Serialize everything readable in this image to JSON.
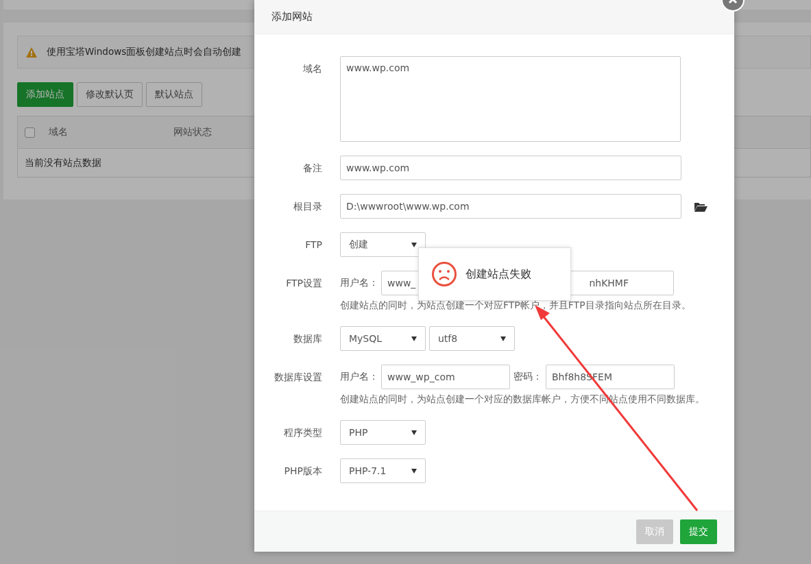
{
  "background": {
    "notice": "使用宝塔Windows面板创建站点时会自动创建",
    "buttons": [
      {
        "label": "添加站点",
        "kind": "primary"
      },
      {
        "label": "修改默认页",
        "kind": "default"
      },
      {
        "label": "默认站点",
        "kind": "default"
      }
    ],
    "table": {
      "header_checked": false,
      "columns": [
        "域名",
        "网站状态"
      ],
      "empty_text": "当前没有站点数据"
    }
  },
  "dialog": {
    "title": "添加网站",
    "rows": [
      {
        "label": "域名",
        "kind": "textarea",
        "value": "www.wp.com"
      },
      {
        "label": "备注",
        "kind": "input",
        "value": "www.wp.com"
      },
      {
        "label": "根目录",
        "kind": "path",
        "value": "D:\\wwwroot\\www.wp.com"
      },
      {
        "label": "FTP",
        "kind": "selects",
        "selects": [
          "创建"
        ]
      },
      {
        "label": "FTP设置",
        "kind": "credentials",
        "user_label": "用户名：",
        "user": "www_",
        "password": "nhKHMF",
        "help": "创建站点的同时，为站点创建一个对应FTP帐户，并且FTP目录指向站点所在目录。"
      },
      {
        "label": "数据库",
        "kind": "selects",
        "selects": [
          "MySQL",
          "utf8"
        ]
      },
      {
        "label": "数据库设置",
        "kind": "credentials",
        "user_label": "用户名：",
        "user": "www_wp_com",
        "password_label": "密码：",
        "password": "Bhf8h8SFEM",
        "help": "创建站点的同时，为站点创建一个对应的数据库帐户，方便不同站点使用不同数据库。"
      },
      {
        "label": "程序类型",
        "kind": "selects",
        "selects": [
          "PHP"
        ]
      },
      {
        "label": "PHP版本",
        "kind": "selects",
        "selects": [
          "PHP-7.1"
        ]
      }
    ],
    "buttons": [
      {
        "label": "取消",
        "kind": "cancel"
      },
      {
        "label": "提交",
        "kind": "submit"
      }
    ]
  },
  "toast": {
    "message": "创建站点失败"
  }
}
